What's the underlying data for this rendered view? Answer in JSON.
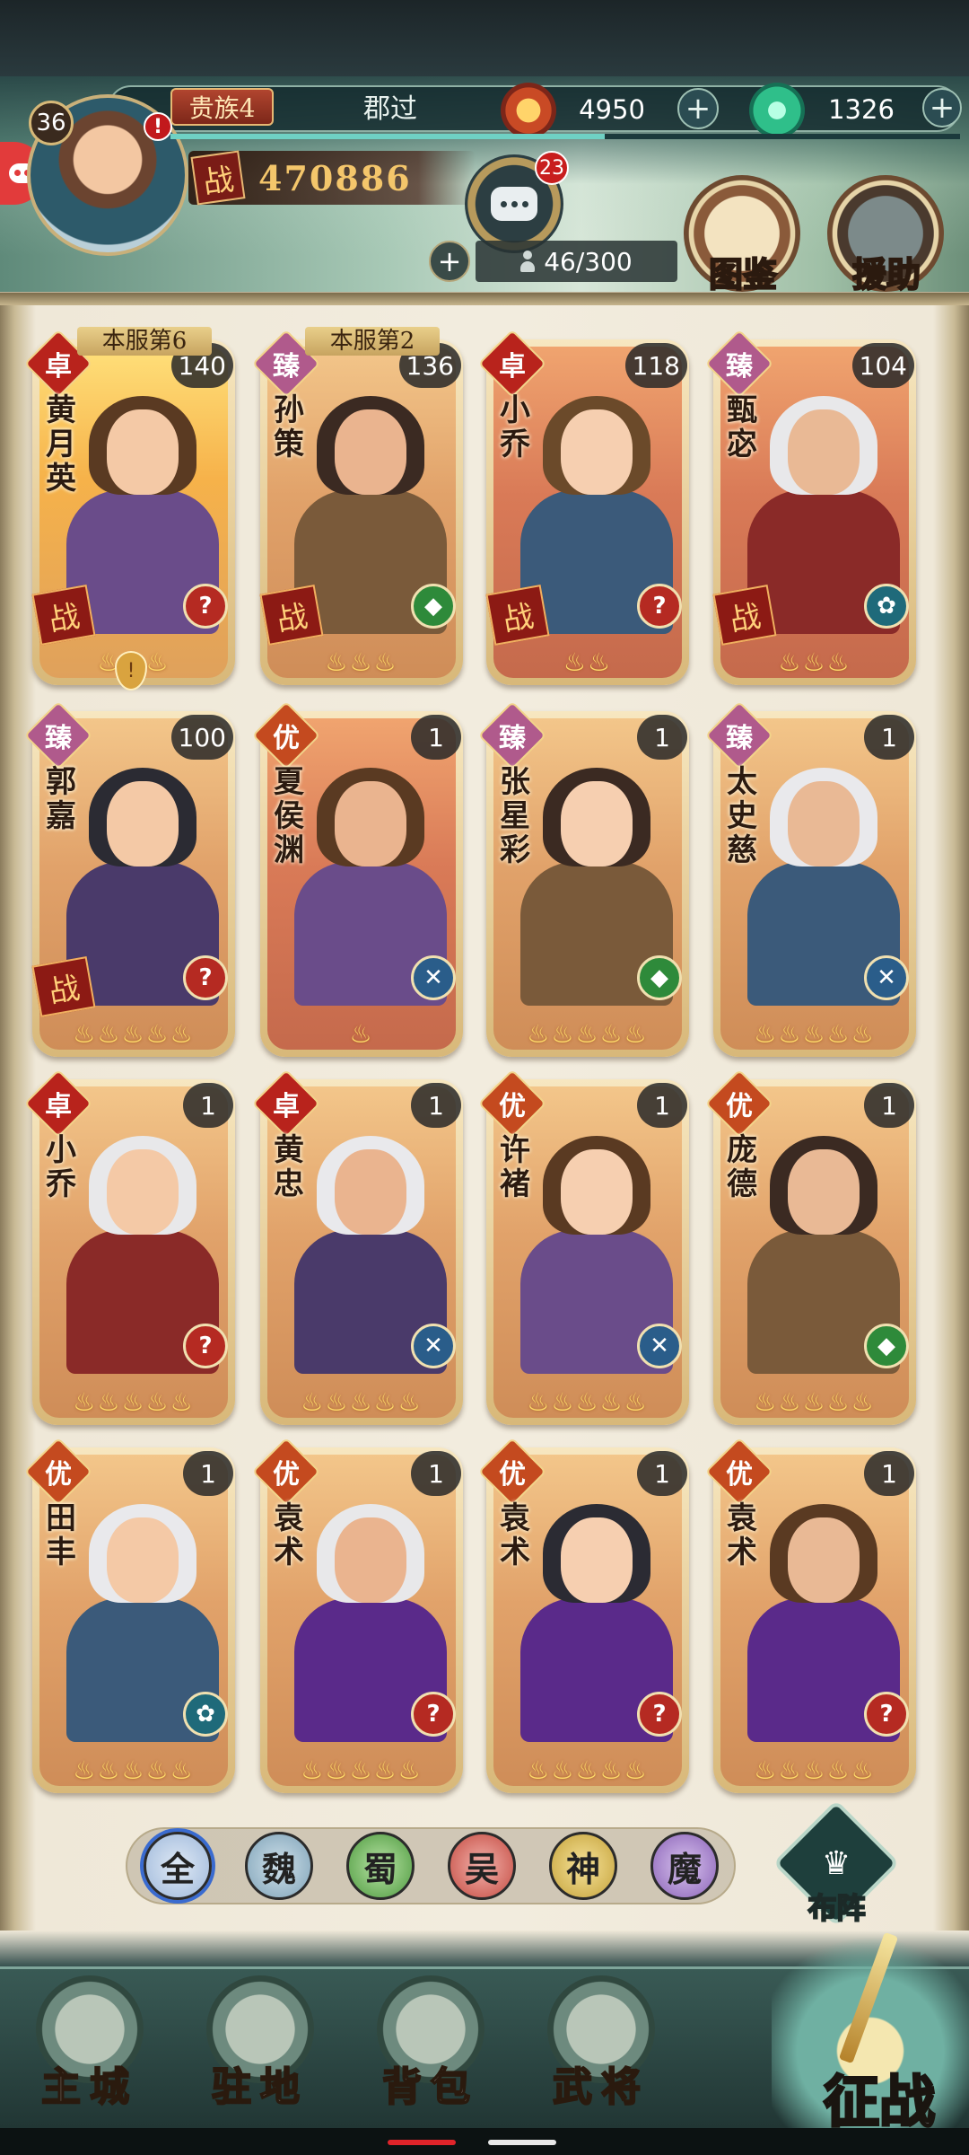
{
  "player": {
    "level": "36",
    "alert": "!",
    "noble_rank": "贵族4",
    "name": "郡过",
    "power_icon": "战",
    "power": "470886",
    "xp_fraction": 0.55
  },
  "resources": {
    "gold": "4950",
    "jade": "1326",
    "plus": "+"
  },
  "chat": {
    "badge": "23"
  },
  "capacity": {
    "plus": "+",
    "value": "46/300"
  },
  "shortcuts": {
    "codex": "图鉴",
    "assist": "援助"
  },
  "heroes": [
    {
      "name": "黄月英",
      "grade": "卓",
      "level": "140",
      "rank": "本服第6",
      "battle": "战",
      "cls": "?",
      "stars": 3,
      "q": "gold",
      "pin": "!"
    },
    {
      "name": "孙策",
      "grade": "臻",
      "level": "136",
      "rank": "本服第2",
      "battle": "战",
      "cls": "◆",
      "stars": 3,
      "q": "orange"
    },
    {
      "name": "小乔",
      "grade": "卓",
      "level": "118",
      "battle": "战",
      "cls": "?",
      "stars": 2,
      "q": "red"
    },
    {
      "name": "甄宓",
      "grade": "臻",
      "level": "104",
      "battle": "战",
      "cls": "✿",
      "stars": 3,
      "q": "red"
    },
    {
      "name": "郭嘉",
      "grade": "臻",
      "level": "100",
      "battle": "战",
      "cls": "?",
      "stars": 5,
      "q": "orange"
    },
    {
      "name": "夏侯渊",
      "grade": "优",
      "level": "1",
      "cls": "✕",
      "stars": 1,
      "q": "red"
    },
    {
      "name": "张星彩",
      "grade": "臻",
      "level": "1",
      "cls": "◆",
      "stars": 5,
      "q": "orange"
    },
    {
      "name": "太史慈",
      "grade": "臻",
      "level": "1",
      "cls": "✕",
      "stars": 5,
      "q": "orange"
    },
    {
      "name": "小乔",
      "grade": "卓",
      "level": "1",
      "cls": "?",
      "stars": 5,
      "q": "orange"
    },
    {
      "name": "黄忠",
      "grade": "卓",
      "level": "1",
      "cls": "✕",
      "stars": 5,
      "q": "orange"
    },
    {
      "name": "许褚",
      "grade": "优",
      "level": "1",
      "cls": "✕",
      "stars": 5,
      "q": "orange"
    },
    {
      "name": "庞德",
      "grade": "优",
      "level": "1",
      "cls": "◆",
      "stars": 5,
      "q": "orange"
    },
    {
      "name": "田丰",
      "grade": "优",
      "level": "1",
      "cls": "✿",
      "stars": 5,
      "q": "orange"
    },
    {
      "name": "袁术",
      "grade": "优",
      "level": "1",
      "cls": "?",
      "stars": 5,
      "q": "orange"
    },
    {
      "name": "袁术",
      "grade": "优",
      "level": "1",
      "cls": "?",
      "stars": 5,
      "q": "orange"
    },
    {
      "name": "袁术",
      "grade": "优",
      "level": "1",
      "cls": "?",
      "stars": 5,
      "q": "orange"
    }
  ],
  "factions": [
    "全",
    "魏",
    "蜀",
    "吴",
    "神",
    "魔"
  ],
  "selected_faction": "全",
  "formation": {
    "label": "布阵"
  },
  "nav": {
    "city": "主城",
    "camp": "驻地",
    "bag": "背包",
    "generals": "武将",
    "campaign": "征战"
  },
  "colors": {
    "accent": "#3a6bd0",
    "alert_red": "#c81e1e",
    "power_gold": "#f4c66b"
  }
}
